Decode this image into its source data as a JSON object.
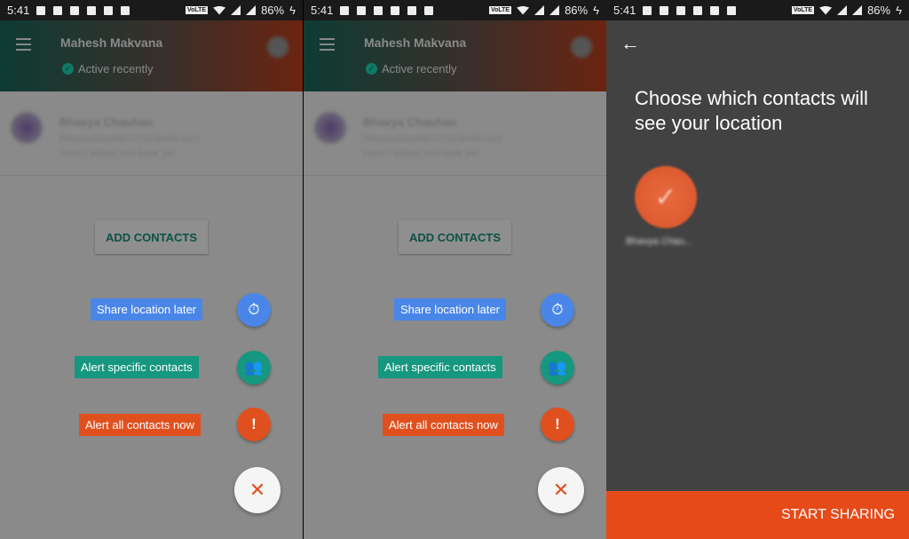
{
  "status_bar": {
    "time": "5:41",
    "network": "VoLTE",
    "battery": "86%"
  },
  "screen1": {
    "header": {
      "name": "Mahesh Makvana",
      "status": "Active recently"
    },
    "contact": {
      "name": "Bhavya Chauhan",
      "email": "bhavyachauhan123@gmail.com",
      "note": "Hasn't added you back yet"
    },
    "add_contacts": "ADD CONTACTS",
    "actions": [
      {
        "label": "Share location later",
        "icon": "timer-icon",
        "color": "#4a86e8"
      },
      {
        "label": "Alert specific contacts",
        "icon": "people-icon",
        "color": "#16977f"
      },
      {
        "label": "Alert all contacts now",
        "icon": "alert-icon",
        "color": "#e0501e"
      }
    ],
    "close_icon": "close-icon"
  },
  "screen2": {
    "title": "Choose which contacts will see your location",
    "selected_contact": "Bhavya Chau...",
    "start_sharing": "START SHARING",
    "accent": "#e64a19"
  }
}
